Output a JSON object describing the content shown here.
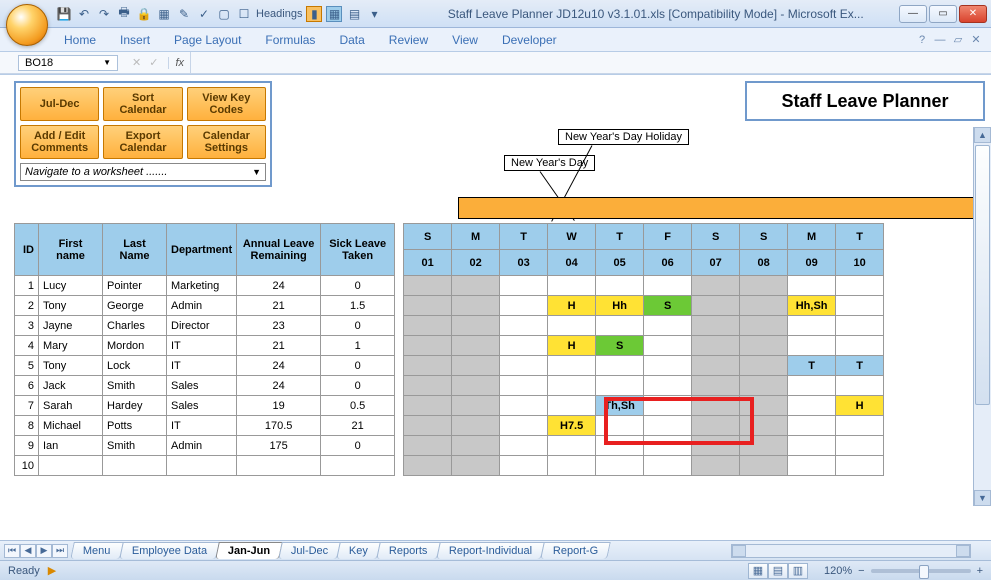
{
  "window": {
    "title": "Staff Leave Planner JD12u10 v3.1.01.xls  [Compatibility Mode] - Microsoft Ex...",
    "headings_label": "Headings"
  },
  "ribbon": {
    "tabs": [
      "Home",
      "Insert",
      "Page Layout",
      "Formulas",
      "Data",
      "Review",
      "View",
      "Developer"
    ]
  },
  "formula": {
    "namebox": "BO18",
    "fx": "fx"
  },
  "buttons": {
    "r1": [
      "Jul-Dec",
      "Sort Calendar",
      "View Key Codes"
    ],
    "r2": [
      "Add / Edit Comments",
      "Export Calendar",
      "Calendar Settings"
    ],
    "nav": "Navigate to a worksheet ......."
  },
  "planner_title": "Staff Leave  Planner",
  "callout1": "New Year's Day Holiday",
  "callout2": "New Year's Day",
  "headers": {
    "id": "ID",
    "fn": "First name",
    "ln": "Last Name",
    "dep": "Department",
    "alr": "Annual Leave Remaining",
    "slt": "Sick Leave Taken",
    "days": [
      "S",
      "M",
      "T",
      "W",
      "T",
      "F",
      "S",
      "S",
      "M",
      "T"
    ],
    "nums": [
      "01",
      "02",
      "03",
      "04",
      "05",
      "06",
      "07",
      "08",
      "09",
      "10"
    ]
  },
  "rows": [
    {
      "id": "1",
      "fn": "Lucy",
      "ln": "Pointer",
      "dep": "Marketing",
      "alr": "24",
      "slt": "0",
      "cal": [
        "we",
        "we",
        "",
        "",
        "",
        "",
        "we",
        "we",
        "",
        ""
      ]
    },
    {
      "id": "2",
      "fn": "Tony",
      "ln": "George",
      "dep": "Admin",
      "alr": "21",
      "slt": "1.5",
      "cal": [
        "we",
        "we",
        "",
        "y:H",
        "y:Hh",
        "g:S",
        "we",
        "we",
        "y:Hh,Sh",
        ""
      ]
    },
    {
      "id": "3",
      "fn": "Jayne",
      "ln": "Charles",
      "dep": "Director",
      "alr": "23",
      "slt": "0",
      "cal": [
        "we",
        "we",
        "",
        "",
        "",
        "",
        "we",
        "we",
        "",
        ""
      ]
    },
    {
      "id": "4",
      "fn": "Mary",
      "ln": "Mordon",
      "dep": "IT",
      "alr": "21",
      "slt": "1",
      "cal": [
        "we",
        "we",
        "",
        "y:H",
        "g:S",
        "",
        "we",
        "we",
        "",
        ""
      ]
    },
    {
      "id": "5",
      "fn": "Tony",
      "ln": "Lock",
      "dep": "IT",
      "alr": "24",
      "slt": "0",
      "cal": [
        "we",
        "we",
        "",
        "",
        "",
        "",
        "we",
        "we",
        "b:T",
        "b:T"
      ]
    },
    {
      "id": "6",
      "fn": "Jack",
      "ln": "Smith",
      "dep": "Sales",
      "alr": "24",
      "slt": "0",
      "cal": [
        "we",
        "we",
        "",
        "",
        "",
        "",
        "we",
        "we",
        "",
        ""
      ]
    },
    {
      "id": "7",
      "fn": "Sarah",
      "ln": "Hardey",
      "dep": "Sales",
      "alr": "19",
      "slt": "0.5",
      "cal": [
        "we",
        "we",
        "",
        "",
        "b:Th,Sh",
        "",
        "we",
        "we",
        "",
        "y:H"
      ]
    },
    {
      "id": "8",
      "fn": "Michael",
      "ln": "Potts",
      "dep": "IT",
      "alr": "170.5",
      "slt": "21",
      "cal": [
        "we",
        "we",
        "",
        "y:H7.5",
        "",
        "",
        "we",
        "we",
        "",
        ""
      ]
    },
    {
      "id": "9",
      "fn": "Ian",
      "ln": "Smith",
      "dep": "Admin",
      "alr": "175",
      "slt": "0",
      "cal": [
        "we",
        "we",
        "",
        "",
        "",
        "",
        "we",
        "we",
        "",
        ""
      ]
    },
    {
      "id": "10",
      "fn": "",
      "ln": "",
      "dep": "",
      "alr": "",
      "slt": "",
      "cal": [
        "we",
        "we",
        "",
        "",
        "",
        "",
        "we",
        "we",
        "",
        ""
      ]
    }
  ],
  "sheet_tabs": [
    "Menu",
    "Employee Data",
    "Jan-Jun",
    "Jul-Dec",
    "Key",
    "Reports",
    "Report-Individual",
    "Report-G"
  ],
  "active_tab_index": 2,
  "status": {
    "ready": "Ready",
    "zoom": "120%"
  }
}
